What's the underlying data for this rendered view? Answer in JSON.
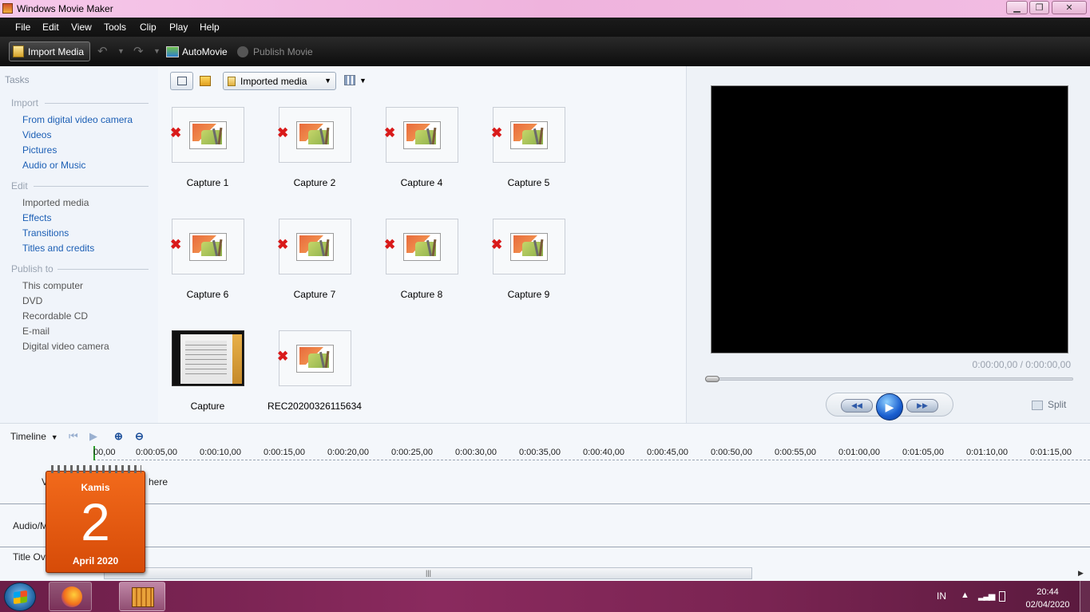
{
  "window": {
    "title": "Windows Movie Maker",
    "minimize": "▁",
    "maximize": "❐",
    "close": "✕"
  },
  "menu": [
    "File",
    "Edit",
    "View",
    "Tools",
    "Clip",
    "Play",
    "Help"
  ],
  "toolbar": {
    "import_label": "Import Media",
    "automovie_label": "AutoMovie",
    "publish_label": "Publish Movie"
  },
  "tasks": {
    "title": "Tasks",
    "import": {
      "heading": "Import",
      "items": [
        "From digital video camera",
        "Videos",
        "Pictures",
        "Audio or Music"
      ]
    },
    "edit": {
      "heading": "Edit",
      "items": [
        "Imported media",
        "Effects",
        "Transitions",
        "Titles and credits"
      ]
    },
    "publish": {
      "heading": "Publish to",
      "items": [
        "This computer",
        "DVD",
        "Recordable CD",
        "E-mail",
        "Digital video camera"
      ]
    }
  },
  "media": {
    "collection": "Imported media",
    "items": [
      "Capture 1",
      "Capture 2",
      "Capture 4",
      "Capture 5",
      "Capture 6",
      "Capture 7",
      "Capture 8",
      "Capture 9",
      "Capture",
      "REC20200326115634"
    ]
  },
  "preview": {
    "time": "0:00:00,00 / 0:00:00,00",
    "split_label": "Split",
    "seek_position": 0
  },
  "timeline": {
    "label": "Timeline",
    "ticks": [
      "00,00",
      "0:00:05,00",
      "0:00:10,00",
      "0:00:15,00",
      "0:00:20,00",
      "0:00:25,00",
      "0:00:30,00",
      "0:00:35,00",
      "0:00:40,00",
      "0:00:45,00",
      "0:00:50,00",
      "0:00:55,00",
      "0:01:00,00",
      "0:01:05,00",
      "0:01:10,00",
      "0:01:15,00"
    ],
    "video_track_fragment_left": "V",
    "video_track_fragment_right": "here",
    "audio_track_fragment": "Audio/M",
    "title_track_fragment": "Title Ov"
  },
  "calendar": {
    "day_name": "Kamis",
    "day": "2",
    "month": "April 2020"
  },
  "taskbar": {
    "language": "IN",
    "time": "20:44",
    "date": "02/04/2020"
  }
}
